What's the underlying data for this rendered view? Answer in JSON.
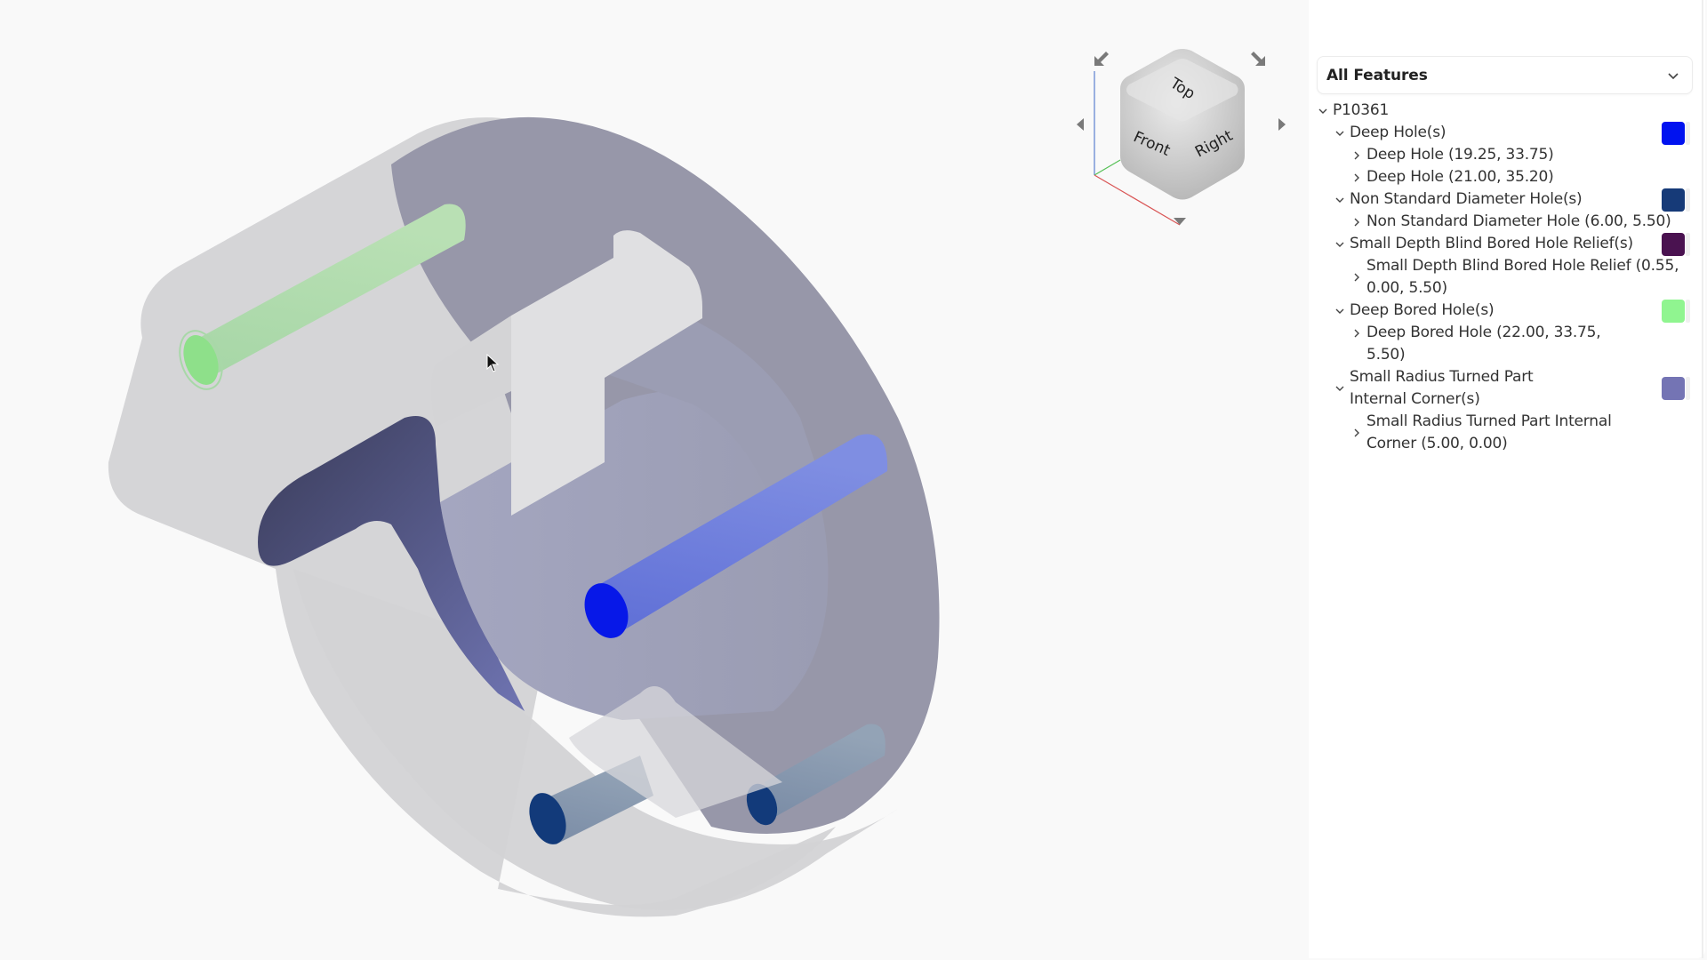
{
  "viewport": {
    "cursor": "arrow-pointer",
    "model": {
      "body_color": "#d4d4d6",
      "flange_face_color": "#9797a9",
      "feature_colors": {
        "deep_hole": "#0012f0",
        "non_standard_diameter_hole": "#163a78",
        "small_depth_blind_bored_hole_relief": "#4a1250",
        "deep_bored_hole": "#90f590",
        "small_radius_turned_part_internal_corner": "#7474b4"
      }
    }
  },
  "viewcube": {
    "faces": {
      "top": "Top",
      "front": "Front",
      "right": "Right"
    },
    "arrows": [
      "rotate-left-up",
      "rotate-right-down",
      "rotate-left",
      "rotate-right",
      "rotate-down"
    ]
  },
  "panel": {
    "filter": {
      "selected": "All Features"
    },
    "tree": {
      "root": {
        "label": "P10361",
        "expanded": true
      },
      "groups": [
        {
          "label": "Deep Hole(s)",
          "color": "#0012f0",
          "expanded": true,
          "items": [
            "Deep Hole (19.25, 33.75)",
            "Deep Hole (21.00, 35.20)"
          ]
        },
        {
          "label": "Non Standard Diameter Hole(s)",
          "color": "#163a78",
          "expanded": true,
          "items": [
            "Non Standard Diameter Hole (6.00, 5.50)"
          ]
        },
        {
          "label": "Small Depth Blind Bored Hole Relief(s)",
          "color": "#4a1250",
          "expanded": true,
          "items": [
            "Small Depth Blind Bored Hole Relief (0.55, 0.00, 5.50)"
          ]
        },
        {
          "label": "Deep Bored Hole(s)",
          "color": "#90f590",
          "expanded": true,
          "items": [
            "Deep Bored Hole (22.00, 33.75, 5.50)"
          ]
        },
        {
          "label": "Small Radius Turned Part Internal Corner(s)",
          "color": "#7474b4",
          "expanded": true,
          "items": [
            "Small Radius Turned Part Internal Corner (5.00, 0.00)"
          ]
        }
      ]
    }
  }
}
